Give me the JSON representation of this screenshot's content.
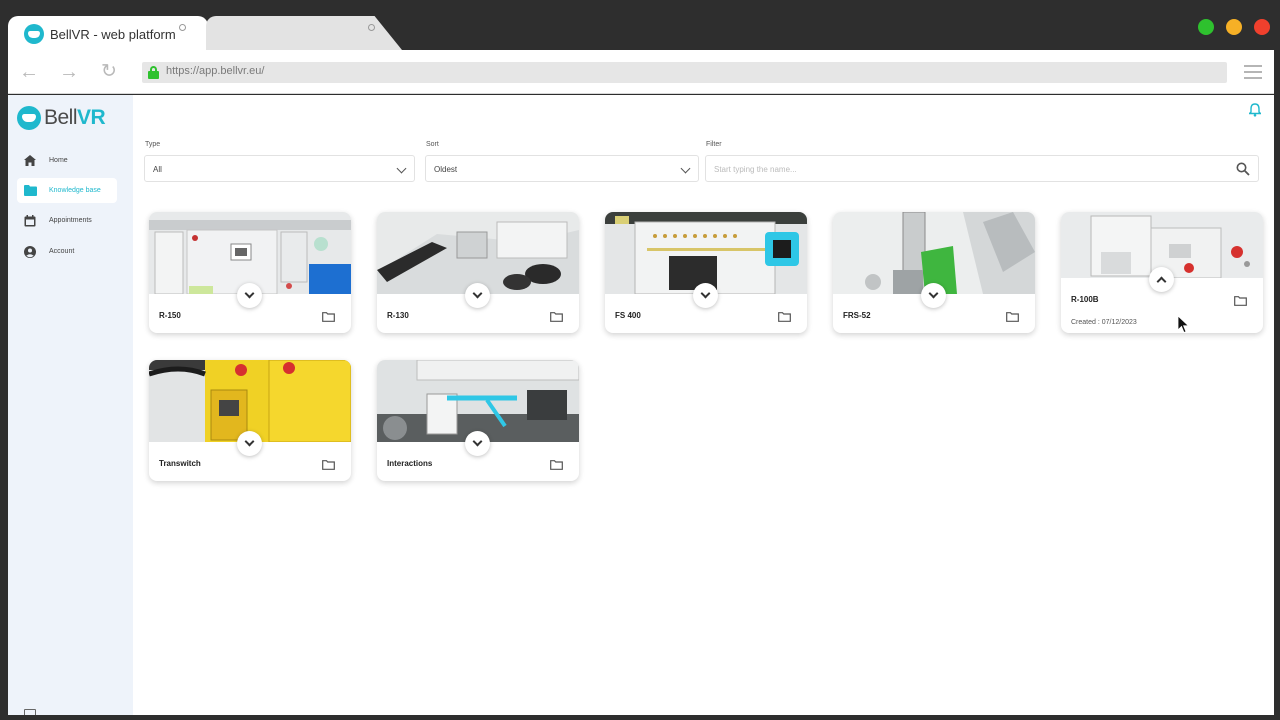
{
  "browser": {
    "active_tab_title": "BellVR - web platform",
    "url": "https://app.bellvr.eu/"
  },
  "app": {
    "logo": {
      "part1": "Bell",
      "part2": "VR"
    },
    "accent_color": "#1fb8cd",
    "nav": [
      {
        "label": "Home",
        "icon": "home-icon",
        "active": false
      },
      {
        "label": "Knowledge base",
        "icon": "folder-icon",
        "active": true
      },
      {
        "label": "Appointments",
        "icon": "calendar-icon",
        "active": false
      },
      {
        "label": "Account",
        "icon": "account-icon",
        "active": false
      }
    ],
    "filters": {
      "type": {
        "label": "Type",
        "value": "All"
      },
      "sort": {
        "label": "Sort",
        "value": "Oldest"
      },
      "filter": {
        "label": "Filter",
        "placeholder": "Start typing the name..."
      }
    },
    "cards": [
      {
        "title": "R-150",
        "expanded": false
      },
      {
        "title": "R-130",
        "expanded": false
      },
      {
        "title": "FS 400",
        "expanded": false
      },
      {
        "title": "FRS-52",
        "expanded": false
      },
      {
        "title": "R-100B",
        "expanded": true,
        "created": "Created : 07/12/2023"
      },
      {
        "title": "Transwitch",
        "expanded": false
      },
      {
        "title": "Interactions",
        "expanded": false
      }
    ]
  }
}
